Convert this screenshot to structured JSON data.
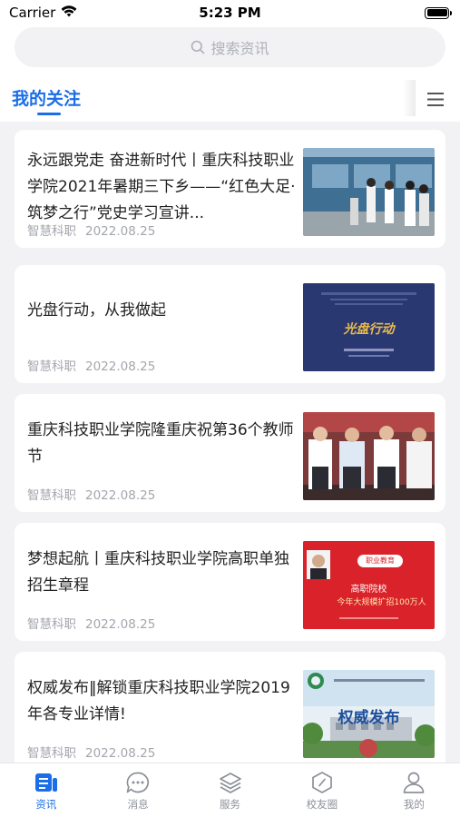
{
  "status_bar": {
    "carrier": "Carrier",
    "time": "5:23 PM"
  },
  "search": {
    "placeholder": "搜索资讯"
  },
  "tabs": {
    "active_label": "我的关注"
  },
  "colors": {
    "accent": "#1a6ee8",
    "meta": "#a3a6ad",
    "background": "#f2f2f4"
  },
  "articles": [
    {
      "title": "永远跟党走 奋进新时代丨重庆科技职业学院2021年暑期三下乡——“红色大足·筑梦之行”党史学习宣讲...",
      "source": "智慧科职",
      "date": "2022.08.25"
    },
    {
      "title": "光盘行动，从我做起",
      "source": "智慧科职",
      "date": "2022.08.25",
      "thumb_caption": "光盘行动"
    },
    {
      "title": "重庆科技职业学院隆重庆祝第36个教师节",
      "source": "智慧科职",
      "date": "2022.08.25"
    },
    {
      "title": "梦想起航丨重庆科技职业学院高职单独招生章程",
      "source": "智慧科职",
      "date": "2022.08.25",
      "thumb_tag": "职业教育",
      "thumb_line1": "高职院校",
      "thumb_line2": "今年大规模扩招100万人"
    },
    {
      "title": "权威发布‖解锁重庆科技职业学院2019年各专业详情!",
      "source": "智慧科职",
      "date": "2022.08.25",
      "thumb_caption": "权威发布"
    }
  ],
  "tab_bar": [
    {
      "label": "资讯",
      "icon": "news-icon",
      "active": true
    },
    {
      "label": "消息",
      "icon": "message-icon",
      "active": false
    },
    {
      "label": "服务",
      "icon": "layers-icon",
      "active": false
    },
    {
      "label": "校友圈",
      "icon": "compass-icon",
      "active": false
    },
    {
      "label": "我的",
      "icon": "person-icon",
      "active": false
    }
  ]
}
